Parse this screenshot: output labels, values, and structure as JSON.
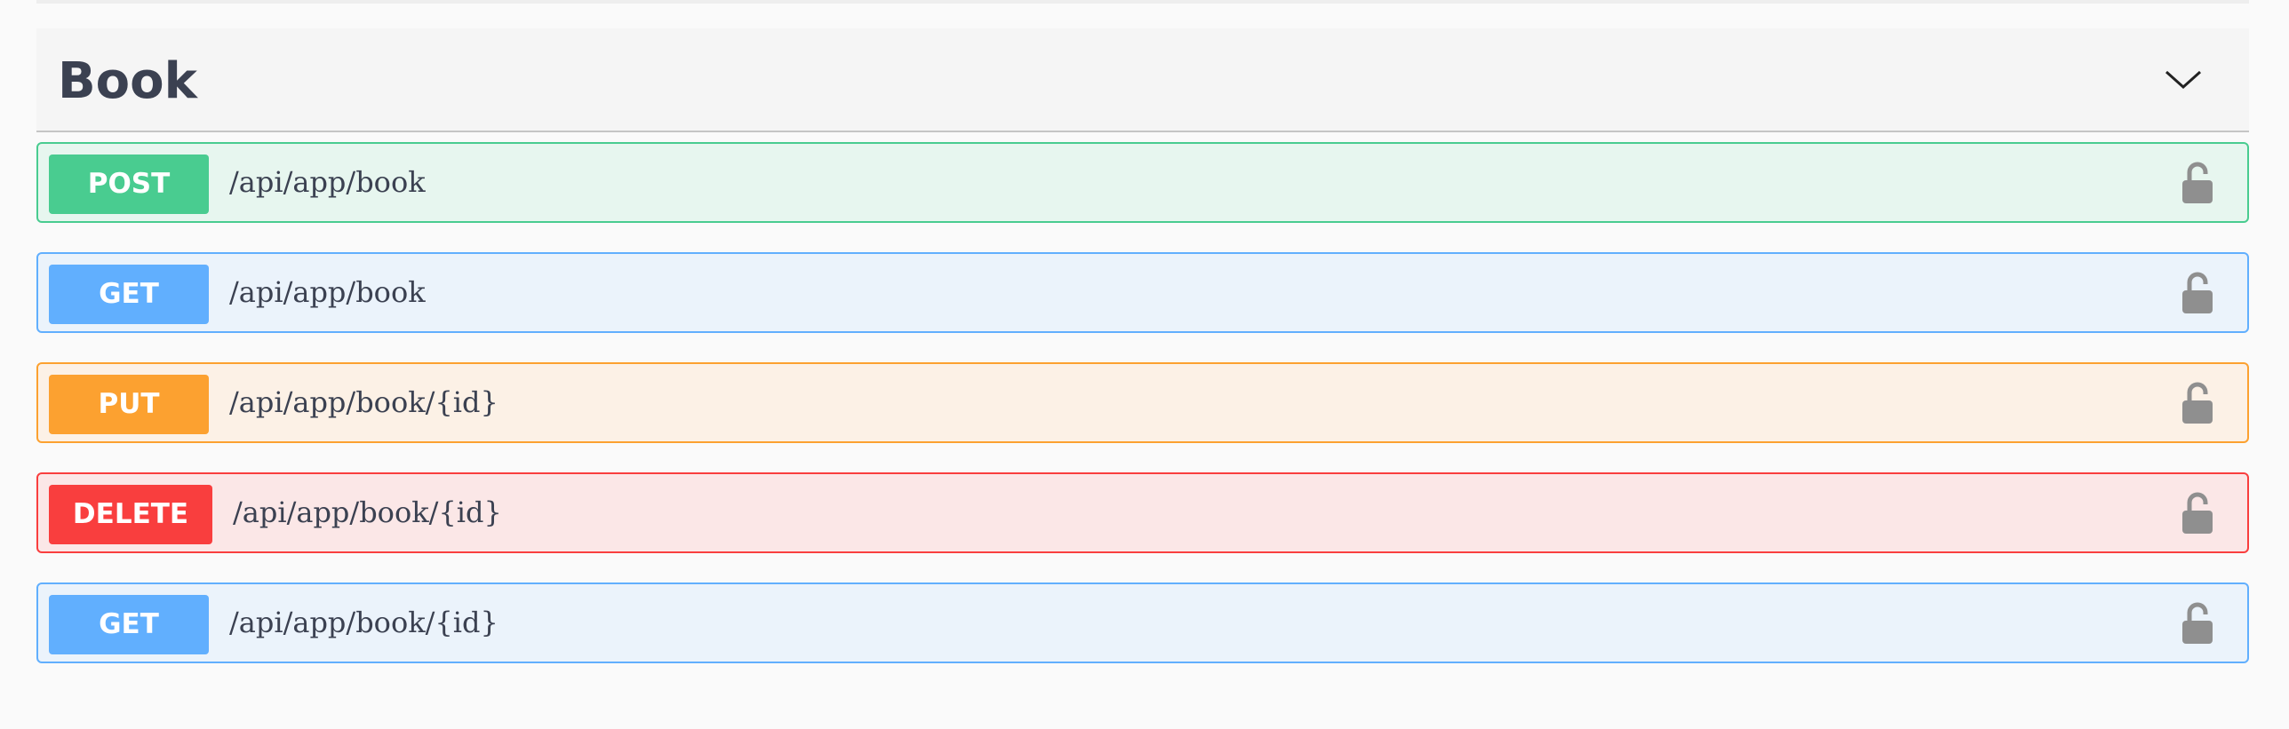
{
  "tag": {
    "title": "Book",
    "collapse_icon": "chevron-down-icon"
  },
  "operations": [
    {
      "method": "POST",
      "path": "/api/app/book",
      "color": "#49cc90",
      "icon": "unlocked-lock-icon"
    },
    {
      "method": "GET",
      "path": "/api/app/book",
      "color": "#61affe",
      "icon": "unlocked-lock-icon"
    },
    {
      "method": "PUT",
      "path": "/api/app/book/{id}",
      "color": "#fca130",
      "icon": "unlocked-lock-icon"
    },
    {
      "method": "DELETE",
      "path": "/api/app/book/{id}",
      "color": "#f93e3e",
      "icon": "unlocked-lock-icon"
    },
    {
      "method": "GET",
      "path": "/api/app/book/{id}",
      "color": "#61affe",
      "icon": "unlocked-lock-icon"
    }
  ]
}
